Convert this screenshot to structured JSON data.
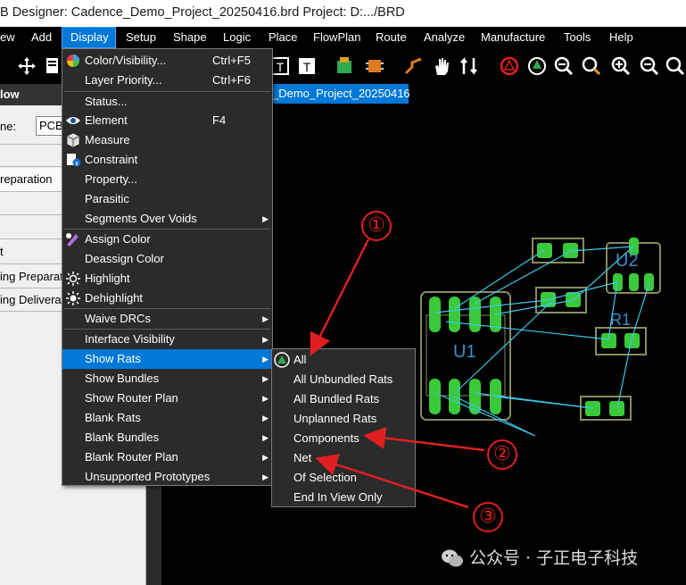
{
  "window": {
    "title": "B Designer: Cadence_Demo_Project_20250416.brd  Project: D:.../BRD"
  },
  "menubar": {
    "items": [
      {
        "label": "ew"
      },
      {
        "label": "Add"
      },
      {
        "label": "Display"
      },
      {
        "label": "Setup"
      },
      {
        "label": "Shape"
      },
      {
        "label": "Logic"
      },
      {
        "label": "Place"
      },
      {
        "label": "FlowPlan"
      },
      {
        "label": "Route"
      },
      {
        "label": "Analyze"
      },
      {
        "label": "Manufacture"
      },
      {
        "label": "Tools"
      },
      {
        "label": "Help"
      }
    ],
    "active": "Display"
  },
  "document_tab": {
    "label": "_Demo_Project_20250416"
  },
  "left_panel": {
    "header": "low",
    "name_label": "ne:",
    "name_value": "PCB",
    "rows": [
      "reparation",
      "t",
      "ing Preparat",
      "ing Deliverat"
    ]
  },
  "display_menu": {
    "items": [
      {
        "label": "Color/Visibility...",
        "shortcut": "Ctrl+F5",
        "icon": "color-wheel-icon"
      },
      {
        "label": "Layer Priority...",
        "shortcut": "Ctrl+F6"
      },
      {
        "label": "Status..."
      },
      {
        "label": "Element",
        "shortcut": "F4",
        "icon": "eye-icon"
      },
      {
        "label": "Measure",
        "icon": "measure-cube-icon"
      },
      {
        "label": "Constraint",
        "icon": "constraint-info-icon"
      },
      {
        "label": "Property..."
      },
      {
        "label": "Parasitic"
      },
      {
        "label": "Segments Over Voids",
        "submenu": true
      },
      {
        "label": "Assign Color",
        "icon": "assign-color-icon"
      },
      {
        "label": "Deassign Color"
      },
      {
        "label": "Highlight",
        "icon": "highlight-sun-icon"
      },
      {
        "label": "Dehighlight",
        "icon": "dehighlight-sun-icon"
      },
      {
        "label": "Waive DRCs",
        "submenu": true
      },
      {
        "label": "Interface Visibility",
        "submenu": true
      },
      {
        "label": "Show Rats",
        "submenu": true,
        "highlighted": true
      },
      {
        "label": "Show Bundles",
        "submenu": true
      },
      {
        "label": "Show Router Plan",
        "submenu": true
      },
      {
        "label": "Blank Rats",
        "submenu": true
      },
      {
        "label": "Blank Bundles",
        "submenu": true
      },
      {
        "label": "Blank Router Plan",
        "submenu": true
      },
      {
        "label": "Unsupported Prototypes",
        "submenu": true
      }
    ]
  },
  "show_rats_submenu": {
    "items": [
      {
        "label": "All",
        "icon": "rats-all-icon"
      },
      {
        "label": "All Unbundled Rats"
      },
      {
        "label": "All Bundled Rats"
      },
      {
        "label": "Unplanned Rats"
      },
      {
        "label": "Components"
      },
      {
        "label": "Net"
      },
      {
        "label": "Of Selection"
      },
      {
        "label": "End In View Only"
      }
    ]
  },
  "pcb_canvas": {
    "designators": [
      "U1",
      "U2",
      "R1"
    ]
  },
  "annotations": {
    "callouts": [
      "①",
      "②",
      "③"
    ],
    "color": "#e02020"
  },
  "watermark": {
    "text": "公众号 · 子正电子科技"
  },
  "colors": {
    "menu_bg": "#2b2b2b",
    "menu_highlight": "#0078d7",
    "rats_line": "#3ec7e8",
    "pad_green": "#39c93a",
    "outline": "#8a8a60"
  }
}
